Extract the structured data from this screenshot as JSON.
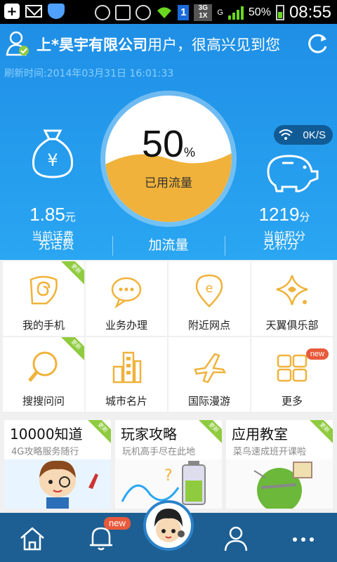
{
  "status_bar": {
    "battery_percent": "50%",
    "time": "08:55",
    "sim_slot": "1",
    "network_3g": "3G",
    "network_1x": "1X",
    "network_g": "G"
  },
  "header": {
    "company": "上*昊宇有限公司",
    "greeting_suffix": "用户，很高兴见到您",
    "refresh_time": "刷新时间:2014年03月31日 16:01:33"
  },
  "stats": {
    "balance_value": "1.85",
    "balance_unit": "元",
    "balance_label": "当前话费",
    "points_value": "1219",
    "points_unit": "分",
    "points_label": "当前积分",
    "speed": "0K/S"
  },
  "dial": {
    "percent_value": "50",
    "percent_sign": "%",
    "label": "已用流量",
    "used_fraction": 0.5
  },
  "actions": [
    {
      "label": "充话费"
    },
    {
      "label": "加流量"
    },
    {
      "label": "兑积分"
    }
  ],
  "grid": [
    {
      "label": "我的手机",
      "icon": "phone-swirl-icon",
      "ribbon": "更新"
    },
    {
      "label": "业务办理",
      "icon": "chat-bubble-icon"
    },
    {
      "label": "附近网点",
      "icon": "location-pin-icon"
    },
    {
      "label": "天翼俱乐部",
      "icon": "star-club-icon"
    },
    {
      "label": "搜搜问问",
      "icon": "magnifier-icon",
      "ribbon": "更新"
    },
    {
      "label": "城市名片",
      "icon": "city-buildings-icon"
    },
    {
      "label": "国际漫游",
      "icon": "airplane-icon"
    },
    {
      "label": "更多",
      "icon": "more-grid-icon",
      "badge": "new"
    }
  ],
  "promos": [
    {
      "title": "10000知道",
      "subtitle": "4G攻略服务随行",
      "ribbon": "更新"
    },
    {
      "title": "玩家攻略",
      "subtitle": "玩机高手尽在此地",
      "ribbon": "更新"
    },
    {
      "title": "应用教室",
      "subtitle": "菜鸟速成班开课啦",
      "ribbon": "更新"
    }
  ],
  "bottom_nav": {
    "notification_badge": "new"
  },
  "colors": {
    "hero_blue": "#1f8fe6",
    "accent_orange": "#f0b23a",
    "nav_blue": "#1d5f93",
    "ribbon_green": "#8fcb3f",
    "badge_red": "#e85a3b"
  }
}
